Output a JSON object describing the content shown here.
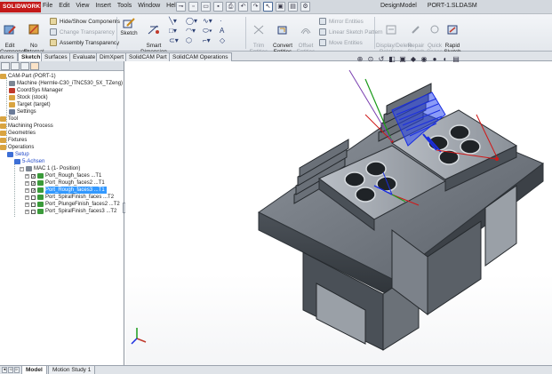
{
  "app": {
    "logo_text": "SOLIDWORKS",
    "doc_title": "DesignModel",
    "file_title": "PORT-1.SLDASM"
  },
  "menu": [
    "File",
    "Edit",
    "View",
    "Insert",
    "Tools",
    "Window",
    "Help"
  ],
  "ribbon": {
    "edit_component": "Edit\nComponent",
    "no_external_refs": "No\nExternal\nReferences",
    "hide_show": "Hide/Show Components",
    "change_transparency": "Change Transparency",
    "assembly_transparency": "Assembly Transparency",
    "sketch": "Sketch",
    "smart_dimension": "Smart\nDimension",
    "trim_entities": "Trim\nEntities",
    "convert_entities": "Convert\nEntities",
    "offset_entities": "Offset\nEntities",
    "mirror_entities": "Mirror Entities",
    "linear_pattern": "Linear Sketch Pattern",
    "move_entities": "Move Entities",
    "display_delete": "Display/Delete\nRelations",
    "repair_sketch": "Repair\nSketch",
    "quick_snaps": "Quick\nSnaps",
    "rapid_sketch": "Rapid\nSketch"
  },
  "cm_tabs": [
    "Features",
    "Sketch",
    "Surfaces",
    "Evaluate",
    "DimXpert",
    "SolidCAM Part",
    "SolidCAM Operations"
  ],
  "tree": {
    "root": "CAM-Part (PORT-1)",
    "machine": "Machine (Hermle-C30_iTNC530_5X_TZeng)",
    "coordsys": "CoordSys Manager",
    "stock": "Stock (stock)",
    "target": "Target (target)",
    "settings": "Settings",
    "tool": "Tool",
    "machining_process": "Machining Process",
    "geometries": "Geometries",
    "fixtures": "Fixtures",
    "operations": "Operations",
    "setup": "Setup",
    "achsen": "5-Achsen",
    "mac": "MAC 1 (1- Position)",
    "ops": [
      "Port_Rough_faces ...T1",
      "Port_Rough_faces2 ...T1",
      "Port_Rough_faces3 ...T1",
      "Port_SpiralFinish_faces ...T2",
      "Port_PlungeFinish_faces2 ...T2",
      "Port_SpiralFinish_faces3 ...T2"
    ]
  },
  "bottom_tabs": [
    "Model",
    "Motion Study 1"
  ],
  "colors": {
    "accent": "#3399ff",
    "logo": "#c41a1a",
    "part": "#5d636b",
    "toolpath": "#1a2ee0"
  }
}
